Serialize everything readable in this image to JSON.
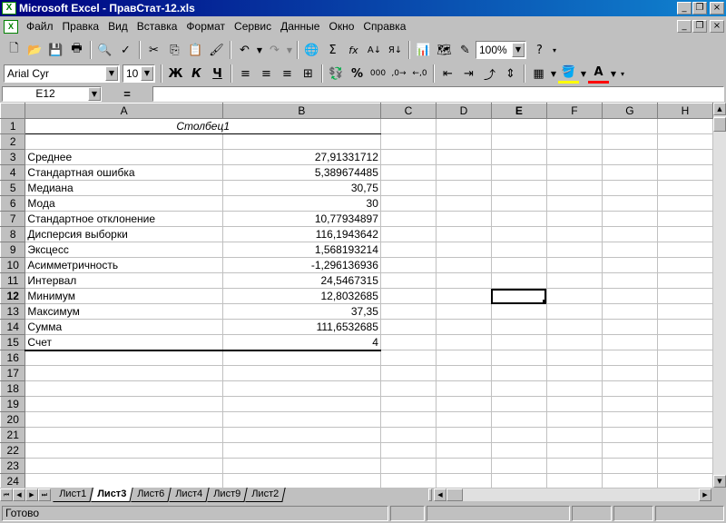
{
  "window": {
    "title": "Microsoft Excel - ПравСтат-12.xls",
    "buttons": [
      "_",
      "❐",
      "×"
    ]
  },
  "menu": {
    "items": [
      "Файл",
      "Правка",
      "Вид",
      "Вставка",
      "Формат",
      "Сервис",
      "Данные",
      "Окно",
      "Справка"
    ],
    "doc_buttons": [
      "_",
      "❐",
      "×"
    ]
  },
  "toolbar1": {
    "icons": [
      "new-icon",
      "open-icon",
      "save-icon",
      "print-icon",
      "print-preview-icon",
      "spelling-icon",
      "cut-icon",
      "copy-icon",
      "paste-icon",
      "format-painter-icon",
      "undo-icon",
      "redo-icon",
      "web-icon",
      "autosum-icon",
      "function-icon",
      "sort-asc-icon",
      "sort-desc-icon",
      "chart-wizard-icon",
      "map-icon",
      "drawing-icon",
      "help-icon"
    ],
    "zoom": "100%"
  },
  "toolbar2": {
    "font": "Arial Cyr",
    "size": "10",
    "bold": "Ж",
    "italic": "К",
    "underline": "Ч",
    "percent": "%",
    "thousands": "000",
    "font_color_letter": "A"
  },
  "formula": {
    "cell_ref": "E12",
    "equals": "=",
    "value": ""
  },
  "grid": {
    "columns": [
      "A",
      "B",
      "C",
      "D",
      "E",
      "F",
      "G",
      "H"
    ],
    "active_column": "E",
    "active_row": 12,
    "header": "Столбец1",
    "rows": [
      {
        "n": "1",
        "a": "",
        "b": ""
      },
      {
        "n": "2",
        "a": "",
        "b": ""
      },
      {
        "n": "3",
        "a": "Среднее",
        "b": "27,91331712"
      },
      {
        "n": "4",
        "a": "Стандартная ошибка",
        "b": "5,389674485"
      },
      {
        "n": "5",
        "a": "Медиана",
        "b": "30,75"
      },
      {
        "n": "6",
        "a": "Мода",
        "b": "30"
      },
      {
        "n": "7",
        "a": "Стандартное отклонение",
        "b": "10,77934897"
      },
      {
        "n": "8",
        "a": "Дисперсия выборки",
        "b": "116,1943642"
      },
      {
        "n": "9",
        "a": "Эксцесс",
        "b": "1,568193214"
      },
      {
        "n": "10",
        "a": "Асимметричность",
        "b": "-1,296136936"
      },
      {
        "n": "11",
        "a": "Интервал",
        "b": "24,5467315"
      },
      {
        "n": "12",
        "a": "Минимум",
        "b": "12,8032685"
      },
      {
        "n": "13",
        "a": "Максимум",
        "b": "37,35"
      },
      {
        "n": "14",
        "a": "Сумма",
        "b": "111,6532685"
      },
      {
        "n": "15",
        "a": "Счет",
        "b": "4"
      },
      {
        "n": "16",
        "a": "",
        "b": ""
      },
      {
        "n": "17",
        "a": "",
        "b": ""
      },
      {
        "n": "18",
        "a": "",
        "b": ""
      },
      {
        "n": "19",
        "a": "",
        "b": ""
      },
      {
        "n": "20",
        "a": "",
        "b": ""
      },
      {
        "n": "21",
        "a": "",
        "b": ""
      },
      {
        "n": "22",
        "a": "",
        "b": ""
      },
      {
        "n": "23",
        "a": "",
        "b": ""
      },
      {
        "n": "24",
        "a": "",
        "b": ""
      }
    ]
  },
  "sheets": {
    "tabs": [
      "Лист1",
      "Лист3",
      "Лист6",
      "Лист4",
      "Лист9",
      "Лист2"
    ],
    "active": "Лист3"
  },
  "status": {
    "text": "Готово"
  }
}
